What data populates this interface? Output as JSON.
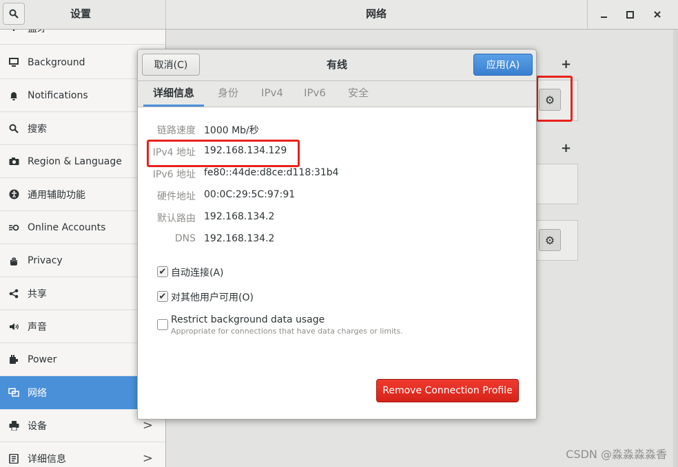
{
  "window": {
    "sidebar_title": "设置",
    "main_title": "网络",
    "controls": {
      "minimize": "–",
      "maximize": "□",
      "close": "✕"
    }
  },
  "sidebar": {
    "partial_top_label": "蓝牙",
    "items": [
      {
        "label": "Background",
        "icon": "display-icon"
      },
      {
        "label": "Notifications",
        "icon": "bell-icon"
      },
      {
        "label": "搜索",
        "icon": "search-icon"
      },
      {
        "label": "Region & Language",
        "icon": "camera-icon"
      },
      {
        "label": "通用辅助功能",
        "icon": "accessibility-icon"
      },
      {
        "label": "Online Accounts",
        "icon": "online-accounts-icon"
      },
      {
        "label": "Privacy",
        "icon": "hand-icon"
      },
      {
        "label": "共享",
        "icon": "share-icon"
      },
      {
        "label": "声音",
        "icon": "speaker-icon"
      },
      {
        "label": "Power",
        "icon": "power-icon"
      },
      {
        "label": "网络",
        "icon": "network-icon",
        "active": true
      },
      {
        "label": "设备",
        "icon": "printer-icon",
        "chevron": ">"
      },
      {
        "label": "详细信息",
        "icon": "info-icon",
        "chevron": ">"
      }
    ]
  },
  "main": {
    "add_symbol": "+",
    "gear_symbol": "⚙"
  },
  "dialog": {
    "title": "有线",
    "cancel_label": "取消(C)",
    "apply_label": "应用(A)",
    "tabs": [
      {
        "label": "详细信息",
        "active": true
      },
      {
        "label": "身份"
      },
      {
        "label": "IPv4"
      },
      {
        "label": "IPv6"
      },
      {
        "label": "安全"
      }
    ],
    "details": [
      {
        "key": "链路速度",
        "value": "1000 Mb/秒"
      },
      {
        "key": "IPv4 地址",
        "value": "192.168.134.129"
      },
      {
        "key": "IPv6 地址",
        "value": "fe80::44de:d8ce:d118:31b4"
      },
      {
        "key": "硬件地址",
        "value": "00:0C:29:5C:97:91"
      },
      {
        "key": "默认路由",
        "value": "192.168.134.2"
      },
      {
        "key": "DNS",
        "value": "192.168.134.2"
      }
    ],
    "checkboxes": [
      {
        "label": "自动连接(A)",
        "checked": true
      },
      {
        "label": "对其他用户可用(O)",
        "checked": true
      },
      {
        "label": "Restrict background data usage",
        "sublabel": "Appropriate for connections that have data charges or limits.",
        "checked": false
      }
    ],
    "remove_label": "Remove Connection Profile"
  },
  "watermark": "CSDN @淼淼淼淼香",
  "colors": {
    "accent": "#4a90d9",
    "danger": "#e8201a",
    "highlight": "#e8201a"
  }
}
